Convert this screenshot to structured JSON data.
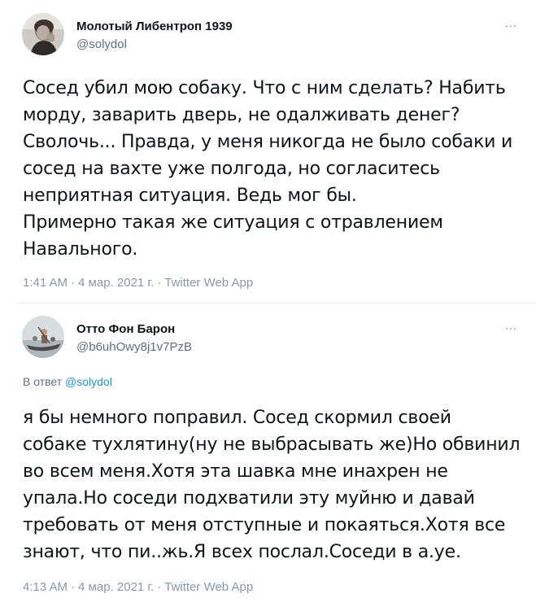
{
  "tweets": [
    {
      "author_name": "Молотый Либентроп 1939",
      "handle": "@solydol",
      "more_icon": "…",
      "text": "Сосед убил мою собаку. Что с ним сделать? Набить\nморду, заварить дверь, не одалживать денег?\nСволочь... Правда, у меня никогда не было собаки и\nсосед на вахте уже полгода, но согласитесь\nнеприятная ситуация. Ведь мог бы.\nПримерно такая же ситуация с отравлением\nНавального.",
      "time": "1:41 AM",
      "date": "4 мар. 2021 г.",
      "source": "Twitter Web App"
    },
    {
      "author_name": "Отто Фон Барон",
      "handle": "@b6uhOwy8j1v7PzB",
      "more_icon": "…",
      "reply_prefix": "В ответ",
      "reply_mention": "@solydol",
      "text": "я бы немного поправил. Сосед скормил своей\nсобаке тухлятину(ну не выбрасывать же)Но обвинил\nво всем меня.Хотя эта шавка мне инахрен не\nупала.Но соседи подхватили эту муйню и давай\nтребовать от меня отступные и покаяться.Хотя все\nзнают, что пи..жь.Я всех послал.Соседи в а.уе.",
      "time": "4:13 AM",
      "date": "4 мар. 2021 г.",
      "source": "Twitter Web App"
    }
  ],
  "meta_separator": "·",
  "colors": {
    "text": "#0f1419",
    "secondary": "#5b7083",
    "link": "#1b95e0",
    "divider": "#e6ecf0"
  }
}
